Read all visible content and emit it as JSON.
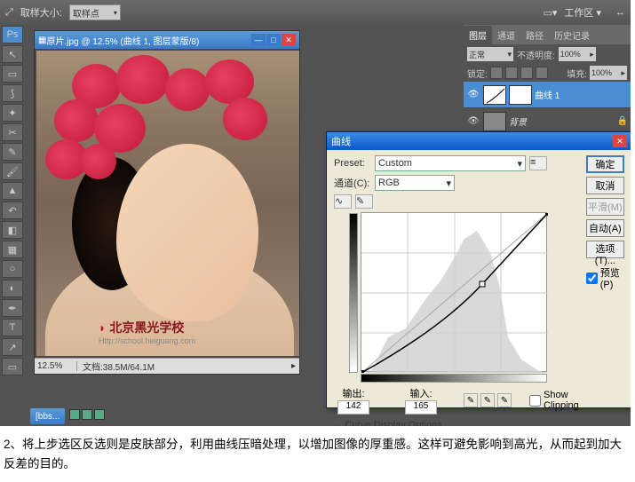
{
  "topbar": {
    "sample_label": "取样大小:",
    "sample_value": "取样点",
    "workspace": "工作区 ▾"
  },
  "doc": {
    "title": "原片.jpg @ 12.5% (曲线 1, 图层蒙版/8)",
    "zoom": "12.5%",
    "status": "文档:38.5M/64.1M"
  },
  "watermark": {
    "main": "北京黑光学校",
    "sub": "Http://school.heiguang.com"
  },
  "panels": {
    "tabs": [
      "图层",
      "通道",
      "路径",
      "历史记录"
    ],
    "blend_label": "正常",
    "opacity_label": "不透明度:",
    "opacity_val": "100%",
    "lock_label": "锁定:",
    "fill_label": "填充:",
    "fill_val": "100%"
  },
  "layers": [
    {
      "name": "曲线 1"
    },
    {
      "name": "背景"
    }
  ],
  "curves": {
    "title": "曲线",
    "preset_label": "Preset:",
    "preset_value": "Custom",
    "channel_label": "通道(C):",
    "channel_value": "RGB",
    "output_label": "输出:",
    "output_value": "142",
    "input_label": "输入:",
    "input_value": "165",
    "show_clip": "Show Clipping",
    "display_options": "Curve Display Options",
    "buttons": {
      "ok": "确定",
      "cancel": "取消",
      "smooth": "平滑(M)",
      "auto": "自动(A)",
      "options": "选项(T)...",
      "preview": "预览(P)"
    }
  },
  "taskbar": {
    "btn1": "[bbs..."
  },
  "caption": "2、将上步选区反选则是皮肤部分，利用曲线压暗处理，以增加图像的厚重感。这样可避免影响到高光，从而起到加大反差的目的。"
}
